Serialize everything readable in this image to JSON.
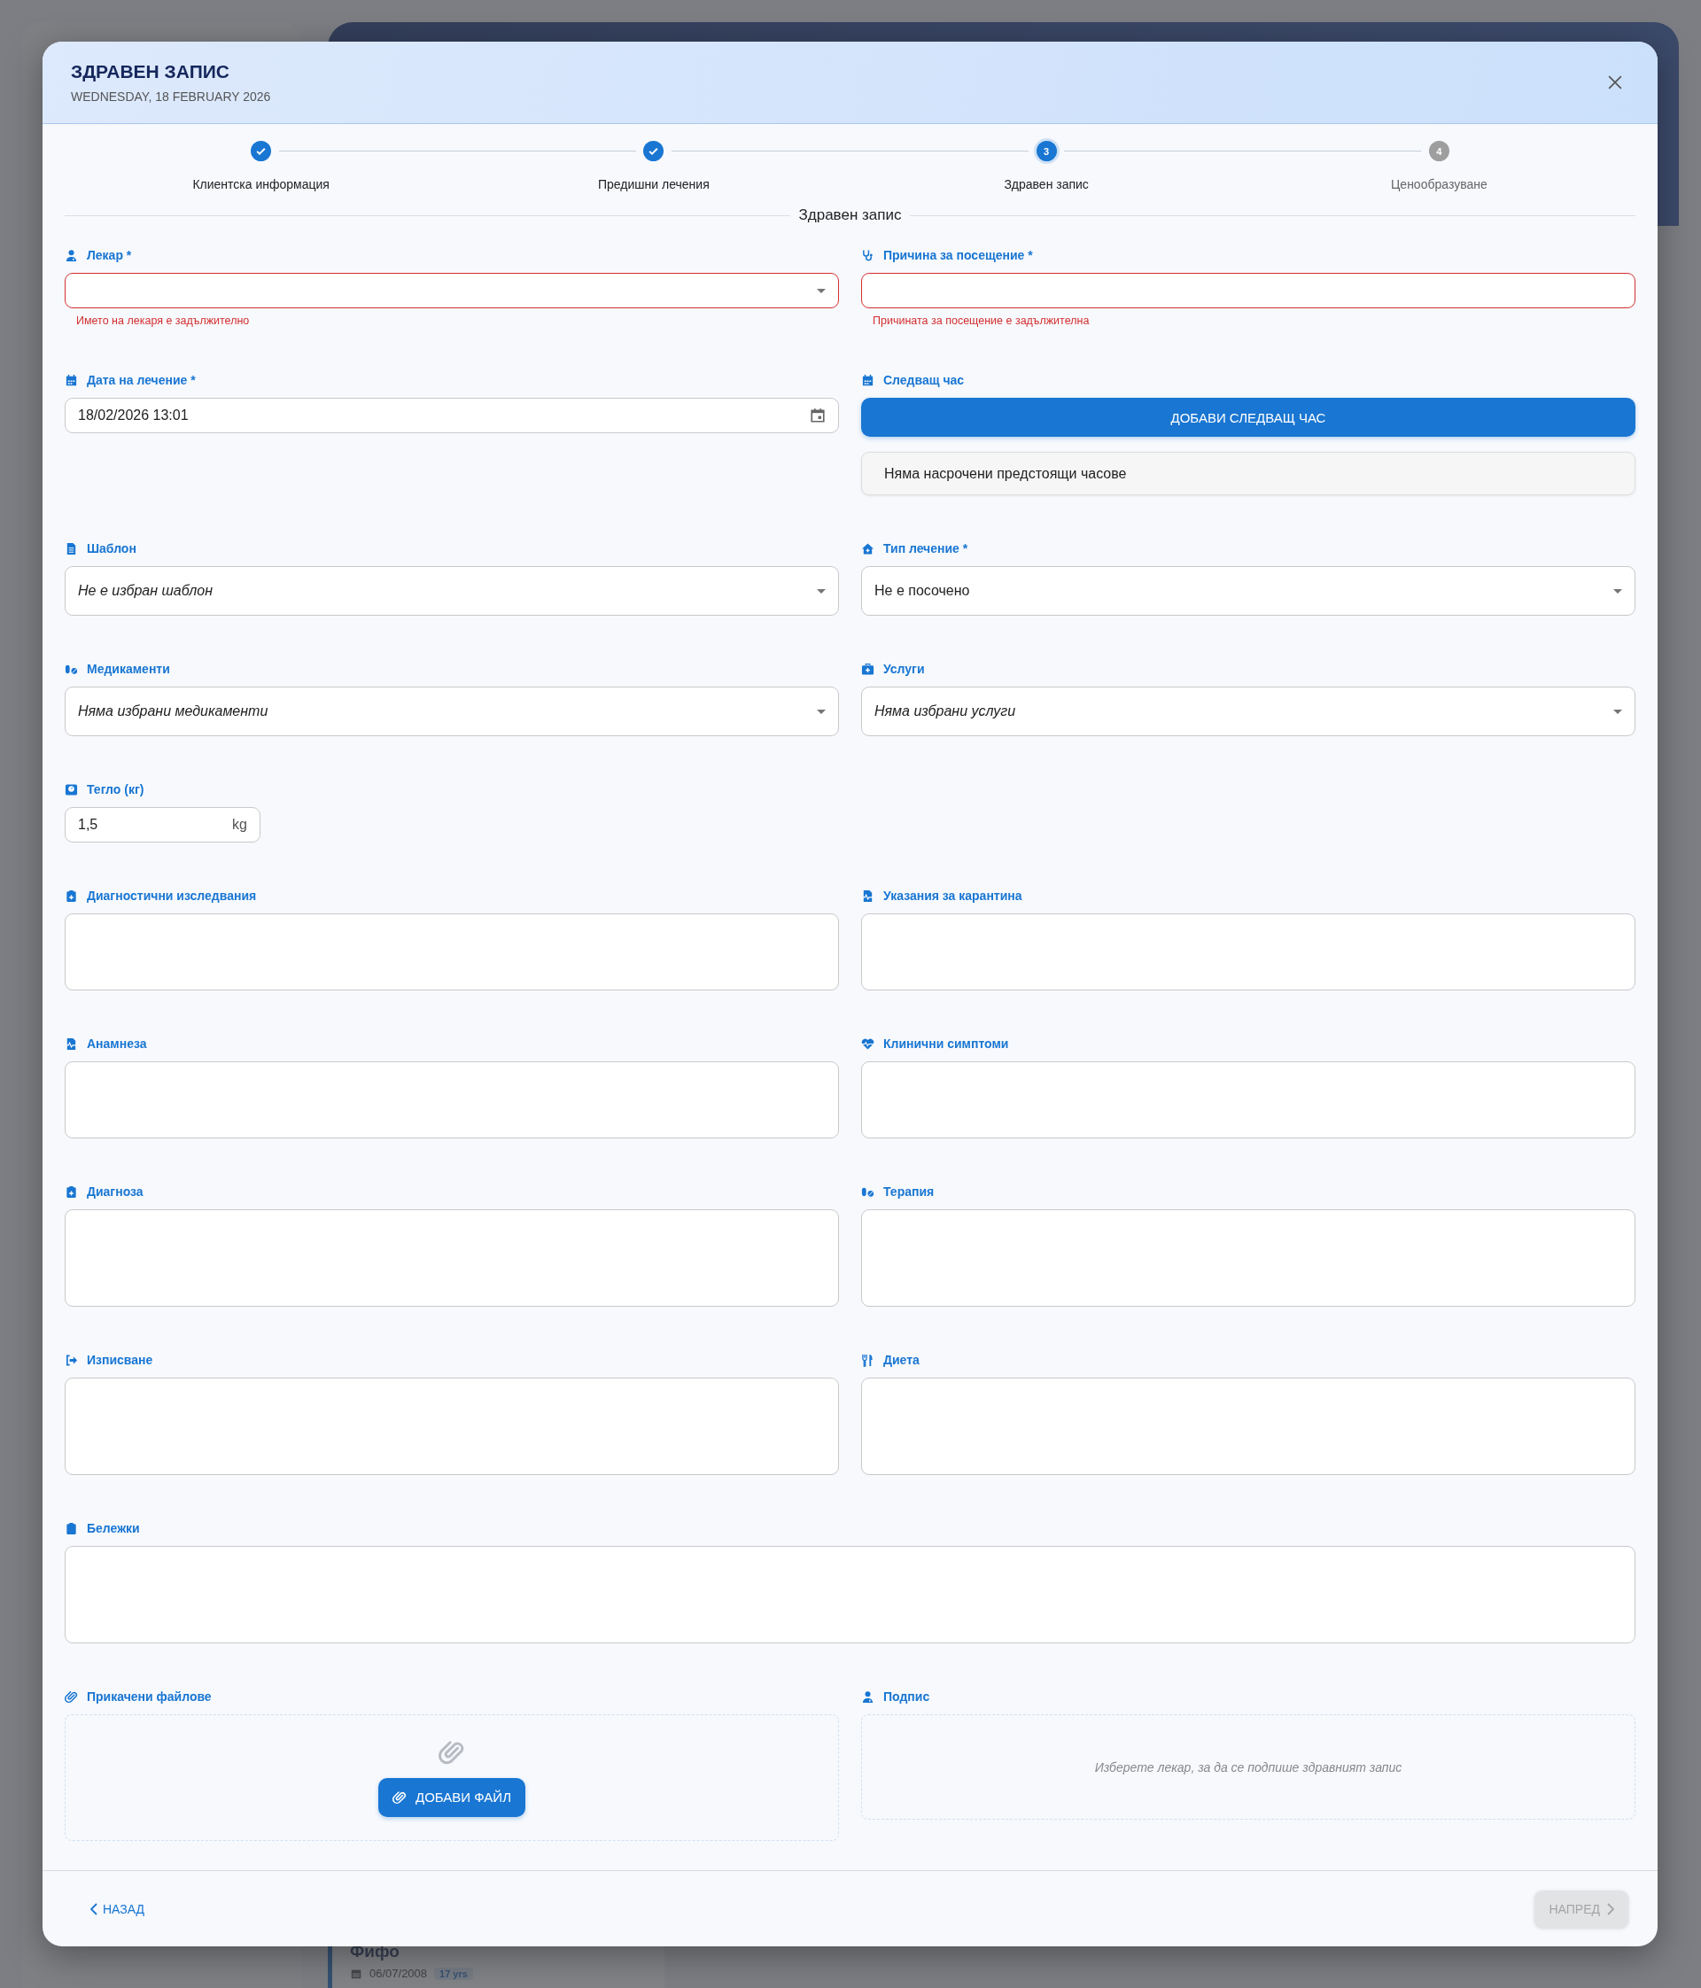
{
  "background": {
    "card": {
      "name": "Фифо",
      "date": "06/07/2008",
      "age": "17 yrs"
    }
  },
  "dialog": {
    "title": "ЗДРАВЕН ЗАПИС",
    "subtitle": "WEDNESDAY, 18 FEBRUARY 2026"
  },
  "steps": [
    {
      "label": "Клиентска информация",
      "completed": true,
      "selected": false
    },
    {
      "label": "Предишни лечения",
      "completed": true,
      "selected": false
    },
    {
      "number": "3",
      "label": "Здравен запис",
      "completed": false,
      "selected": true
    },
    {
      "number": "4",
      "label": "Ценообразуване",
      "completed": false,
      "selected": false
    }
  ],
  "section_title": "Здравен запис",
  "rows": [
    [
      {
        "kind": "select",
        "label": "Лекар *",
        "error": "Името на лекаря е задължително"
      },
      {
        "kind": "text",
        "label": "Причина за посещение *",
        "error": "Причината за посещение е задължителна"
      }
    ],
    [
      {
        "kind": "date",
        "label": "Дата на лечение *",
        "value": "18/02/2026 13:01"
      },
      {
        "kind": "appointments",
        "label": "Следващ час",
        "button": "ДОБАВИ СЛЕДВАЩ ЧАС",
        "empty": "Няма насрочени предстоящи часове"
      }
    ],
    [
      {
        "kind": "select",
        "label": "Шаблон",
        "placeholder": "Не е избран шаблон"
      },
      {
        "kind": "select",
        "label": "Тип лечение *",
        "value": "Не е посочено"
      }
    ],
    [
      {
        "kind": "select",
        "label": "Медикаменти",
        "placeholder": "Няма избрани медикаменти"
      },
      {
        "kind": "select",
        "label": "Услуги",
        "placeholder": "Няма избрани услуги"
      }
    ],
    [
      {
        "kind": "number",
        "label": "Тегло (кг)",
        "value": "1,5",
        "unit": "kg"
      }
    ],
    [
      {
        "kind": "textarea",
        "label": "Диагностични изследвания"
      },
      {
        "kind": "textarea",
        "label": "Указания за карантина"
      }
    ],
    [
      {
        "kind": "textarea",
        "label": "Анамнеза"
      },
      {
        "kind": "textarea",
        "label": "Клинични симптоми"
      }
    ],
    [
      {
        "kind": "textarea",
        "label": "Диагноза"
      },
      {
        "kind": "textarea",
        "label": "Терапия"
      }
    ],
    [
      {
        "kind": "textarea",
        "label": "Изписване"
      },
      {
        "kind": "textarea",
        "label": "Диета"
      }
    ],
    [
      {
        "kind": "textarea",
        "label": "Бележки",
        "full_width": true
      }
    ],
    [
      {
        "kind": "attachments",
        "label": "Прикачени файлове",
        "button": "ДОБАВИ ФАЙЛ"
      },
      {
        "kind": "signature",
        "label": "Подпис",
        "hint": "Изберете лекар, за да се подпише здравният запис"
      }
    ]
  ],
  "footer": {
    "back": "НАЗАД",
    "next": {
      "label": "НАПРЕД",
      "disabled": true
    }
  }
}
